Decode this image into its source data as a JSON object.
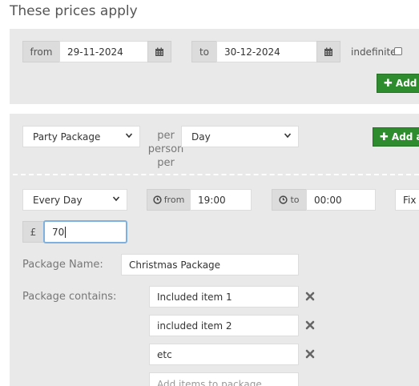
{
  "heading": "These prices apply",
  "dates": {
    "from_label": "from",
    "from_value": "29-11-2024",
    "to_label": "to",
    "to_value": "30-12-2024",
    "indefinite_label": "indefinite",
    "add_button_label": "Add a"
  },
  "package_row": {
    "package_select": "Party Package",
    "per_text": "per person per",
    "per_select": "Day",
    "add_button_label": "Add al"
  },
  "schedule": {
    "days_select": "Every Day",
    "from_label": "from",
    "from_time": "19:00",
    "to_label": "to",
    "to_time": "00:00",
    "fixed_label": "Fix"
  },
  "price": {
    "currency": "£",
    "value": "70"
  },
  "package_name": {
    "label": "Package Name:",
    "value": "Christmas Package"
  },
  "package_contains": {
    "label": "Package contains:",
    "items": [
      "Included item 1",
      "included item 2",
      "etc"
    ],
    "add_placeholder": "Add items to package"
  },
  "colors": {
    "accent_green": "#2e8b2e",
    "panel_bg": "#e9e9e9",
    "focus_blue": "#7fb1e0"
  }
}
